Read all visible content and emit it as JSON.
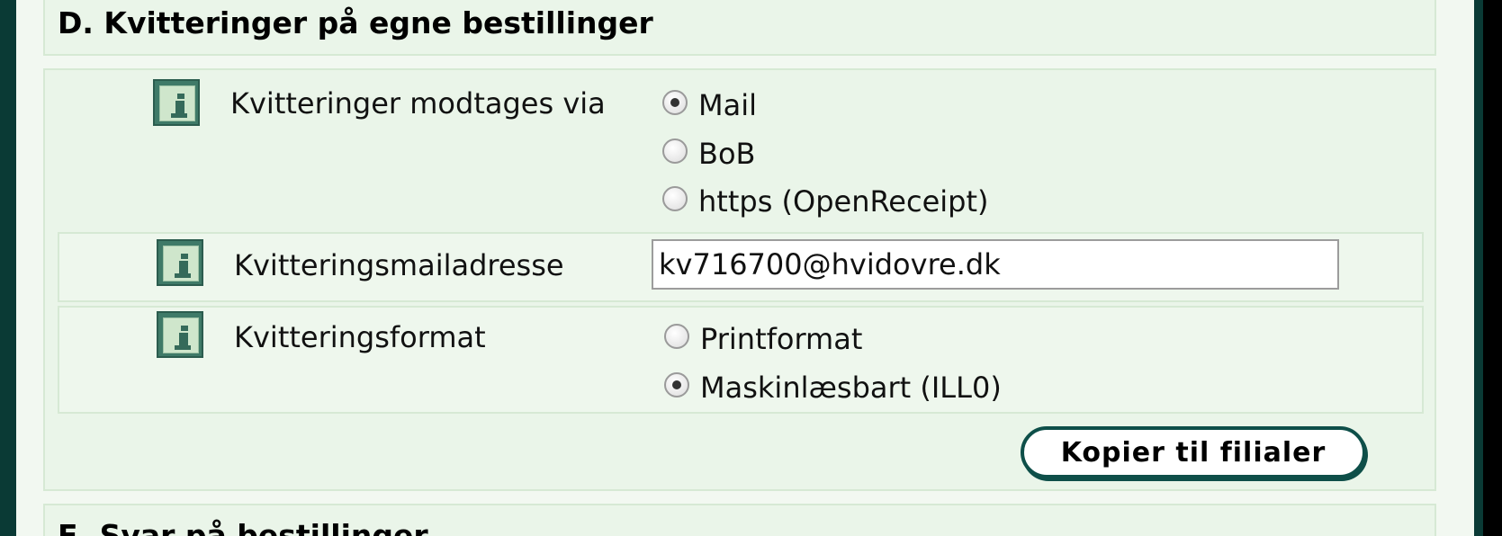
{
  "section_d": {
    "title": "D. Kvitteringer på egne bestillinger",
    "receipt_method": {
      "label": "Kvitteringer modtages via",
      "options": [
        {
          "label": "Mail",
          "checked": true
        },
        {
          "label": "BoB",
          "checked": false
        },
        {
          "label": "https (OpenReceipt)",
          "checked": false
        }
      ]
    },
    "receipt_email": {
      "label": "Kvitteringsmailadresse",
      "value": "kv716700@hvidovre.dk"
    },
    "receipt_format": {
      "label": "Kvitteringsformat",
      "options": [
        {
          "label": "Printformat",
          "checked": false
        },
        {
          "label": "Maskinlæsbart (ILL0)",
          "checked": true
        }
      ]
    },
    "copy_button_label": "Kopier til filialer"
  },
  "section_e": {
    "title": "E. Svar på bestillinger"
  }
}
